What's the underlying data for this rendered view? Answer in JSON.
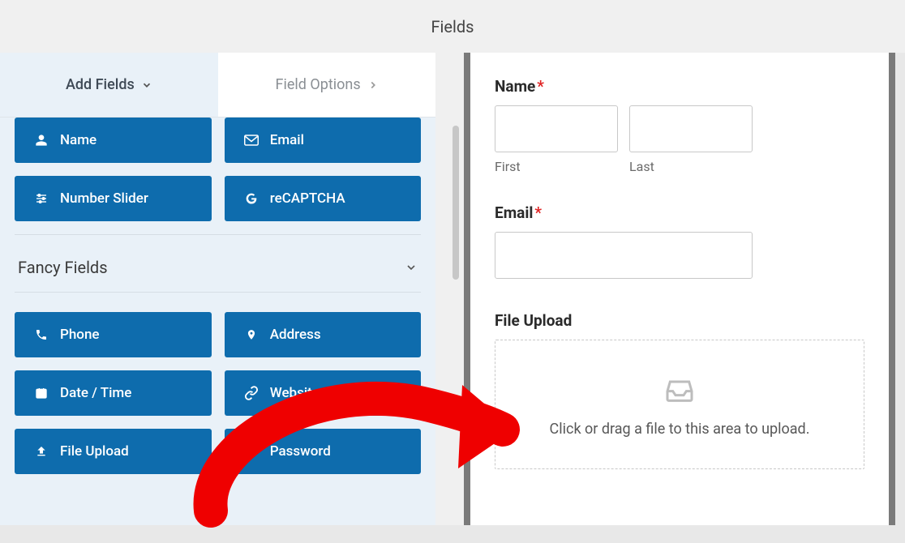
{
  "header": {
    "title": "Fields"
  },
  "tabs": {
    "add_fields": "Add Fields",
    "field_options": "Field Options"
  },
  "section": {
    "fancy": "Fancy Fields"
  },
  "fields": {
    "name": "Name",
    "email": "Email",
    "number_slider": "Number Slider",
    "recaptcha": "reCAPTCHA",
    "phone": "Phone",
    "address": "Address",
    "date_time": "Date / Time",
    "website_url": "Website / URL",
    "file_upload": "File Upload",
    "password": "Password"
  },
  "preview": {
    "name_label": "Name",
    "first": "First",
    "last": "Last",
    "email_label": "Email",
    "file_upload_label": "File Upload",
    "dropzone_text": "Click or drag a file to this area to upload."
  }
}
